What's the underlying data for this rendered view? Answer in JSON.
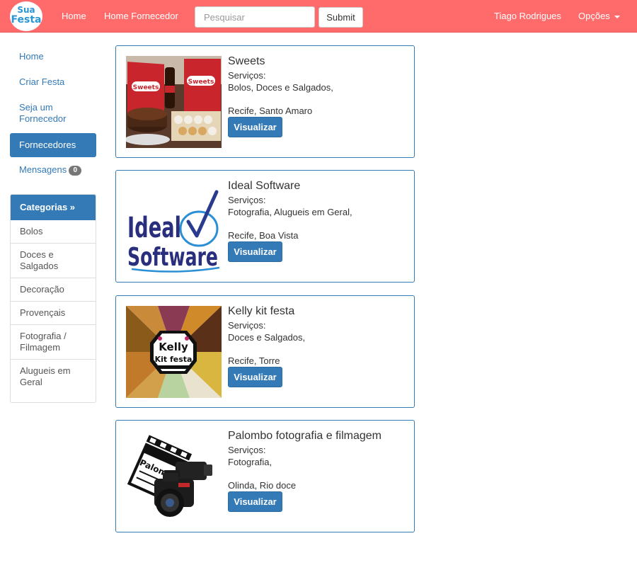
{
  "navbar": {
    "logo_text_1": "Sua",
    "logo_text_2": "Festa",
    "links": [
      {
        "label": "Home"
      },
      {
        "label": "Home Fornecedor"
      }
    ],
    "search_placeholder": "Pesquisar",
    "search_value": "",
    "submit_label": "Submit",
    "user_name": "Tiago Rodrigues",
    "options_label": "Opções",
    "background_color": "#ff6b6b"
  },
  "sidebar": {
    "links": [
      {
        "label": "Home"
      },
      {
        "label": "Criar Festa"
      },
      {
        "label": "Seja um Fornecedor"
      },
      {
        "label": "Fornecedores",
        "active": true
      },
      {
        "label": "Mensagens",
        "badge": "0"
      }
    ],
    "categories_header": "Categorias »",
    "categories": [
      {
        "label": "Bolos"
      },
      {
        "label": "Doces e Salgados"
      },
      {
        "label": "Decoração"
      },
      {
        "label": "Provençais"
      },
      {
        "label": "Fotografia / Filmagem"
      },
      {
        "label": "Alugueis em Geral"
      }
    ]
  },
  "suppliers": [
    {
      "name": "Sweets",
      "services_label": "Serviços:",
      "services": "Bolos, Doces e Salgados,",
      "location": "Recife, Santo Amaro",
      "button_label": "Visualizar",
      "image": {
        "icon": "sweets-cake-photo",
        "text": "Sweets"
      }
    },
    {
      "name": "Ideal Software",
      "services_label": "Serviços:",
      "services": "Fotografia, Alugueis em Geral,",
      "location": "Recife, Boa Vista",
      "button_label": "Visualizar",
      "image": {
        "icon": "ideal-software-logo",
        "text_1": "Ideal",
        "text_2": "Software"
      }
    },
    {
      "name": "Kelly kit festa",
      "services_label": "Serviços:",
      "services": "Doces e Salgados,",
      "location": "Recife, Torre",
      "button_label": "Visualizar",
      "image": {
        "icon": "kelly-kit-festa-collage",
        "text_1": "Kelly",
        "text_2": "Kit festa"
      }
    },
    {
      "name": "Palombo fotografia e filmagem",
      "services_label": "Serviços:",
      "services": "Fotografia,",
      "location": "Olinda, Rio doce",
      "button_label": "Visualizar",
      "image": {
        "icon": "camera-clapboard-photo",
        "text": "Palombo"
      }
    }
  ],
  "colors": {
    "primary": "#337ab7",
    "navbar": "#ff6b6b",
    "badge": "#777777"
  }
}
